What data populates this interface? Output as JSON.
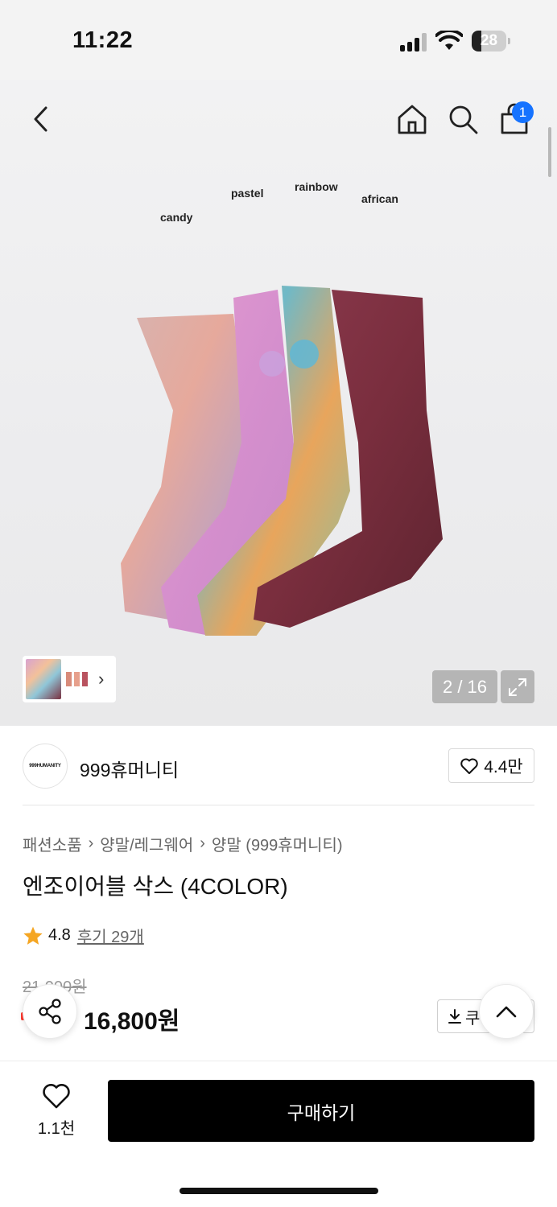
{
  "status_bar": {
    "time": "11:22",
    "battery": "28",
    "battery_level": 0.28
  },
  "hero": {
    "labels": [
      "candy",
      "pastel",
      "rainbow",
      "african"
    ],
    "cart_count": "1",
    "page_counter": "2 / 16"
  },
  "brand": {
    "logo_text": "999HUMANITY",
    "name": "999휴머니티",
    "likes": "4.4만"
  },
  "breadcrumb": [
    "패션소품",
    "양말/레그웨어",
    "양말 (999휴머니티)"
  ],
  "product": {
    "title": "엔조이어블 삭스 (4COLOR)",
    "rating": "4.8",
    "reviews": "후기 29개",
    "original_price": "21,000원",
    "sale_price": "16,800원",
    "coupon_label": "쿠"
  },
  "bottom": {
    "wish_count": "1.1천",
    "buy_label": "구매하기"
  },
  "colors": {
    "accent": "#1673ff",
    "star": "#f5a623",
    "buy": "#000000"
  }
}
